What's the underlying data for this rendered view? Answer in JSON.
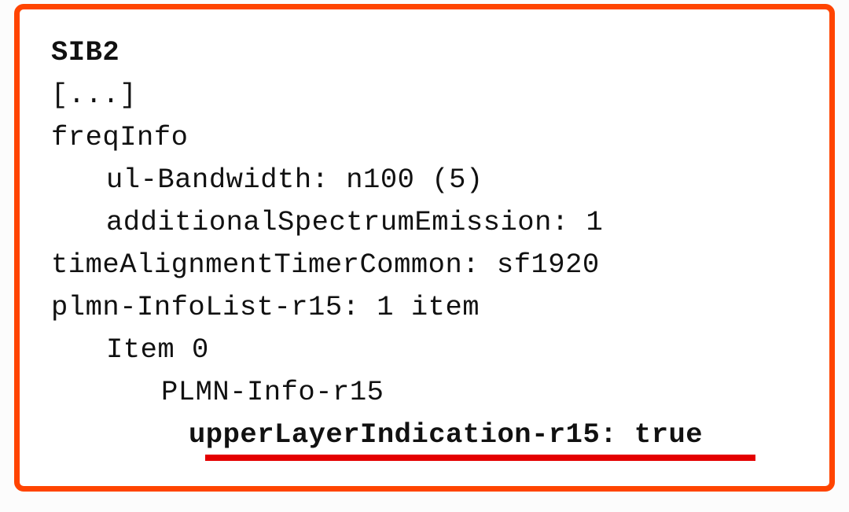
{
  "sib2": {
    "title": "SIB2",
    "ellipsis": "[...]",
    "freqInfoLabel": "freqInfo",
    "ulBandwidth": "ul-Bandwidth: n100 (5)",
    "additionalSpectrumEmission": "additionalSpectrumEmission: 1",
    "timeAlignmentTimerCommon": "timeAlignmentTimerCommon: sf1920",
    "plmnInfoList": "plmn-InfoList-r15: 1 item",
    "item0": "Item 0",
    "plmnInfo": "PLMN-Info-r15",
    "upperLayerIndication": "upperLayerIndication-r15: true"
  }
}
